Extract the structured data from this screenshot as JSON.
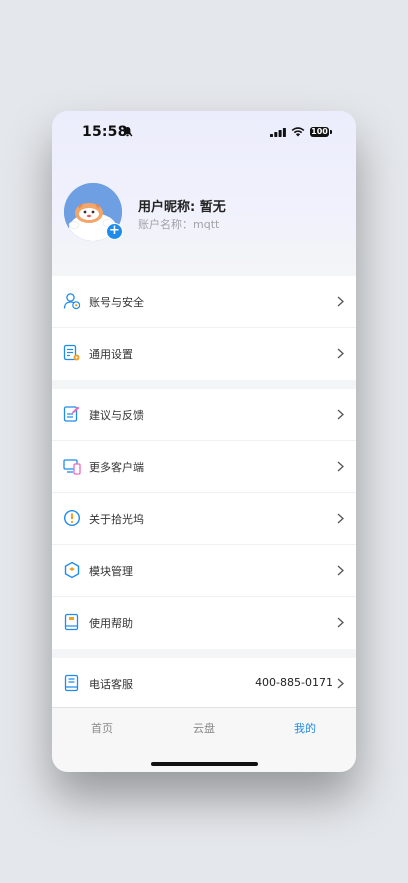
{
  "status_bar": {
    "time": "15:58",
    "battery": "100"
  },
  "profile": {
    "nickname": "用户昵称: 暂无",
    "account_name": "账户名称：mqtt",
    "avatar_add": "+"
  },
  "menu_sections": [
    [
      {
        "label": "账号与安全",
        "icon": "user-shield-icon"
      },
      {
        "label": "通用设置",
        "icon": "settings-doc-icon"
      }
    ],
    [
      {
        "label": "建议与反馈",
        "icon": "feedback-edit-icon"
      },
      {
        "label": "更多客户端",
        "icon": "devices-icon"
      },
      {
        "label": "关于拾光坞",
        "icon": "info-exclamation-icon"
      },
      {
        "label": "模块管理",
        "icon": "module-hexagon-icon"
      },
      {
        "label": "使用帮助",
        "icon": "help-book-icon"
      }
    ],
    [
      {
        "label": "电话客服",
        "icon": "phone-book-icon",
        "value": "400-885-0171"
      }
    ]
  ],
  "tabs": [
    {
      "label": "首页",
      "active": false
    },
    {
      "label": "云盘",
      "active": false
    },
    {
      "label": "我的",
      "active": true
    }
  ],
  "colors": {
    "accent": "#1f8ceb",
    "icon_orange": "#f0a020",
    "icon_pink": "#e86cc0"
  }
}
